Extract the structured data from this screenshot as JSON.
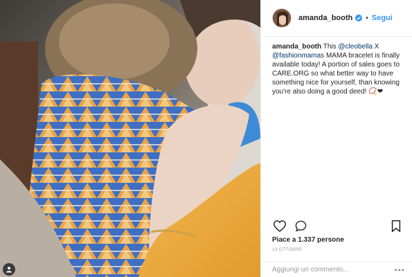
{
  "post": {
    "image_alt": "Woman hugging a child wearing a patterned jacket",
    "tag_icon": "person-tag-icon"
  },
  "header": {
    "username": "amanda_booth",
    "verified_icon": "verified-badge-icon",
    "separator": "•",
    "follow_label": "Segui"
  },
  "caption": {
    "username": "amanda_booth",
    "text_before": "This ",
    "mention1": "@cleobella",
    "text_mid": " X ",
    "mention2": "@fashionmamas",
    "text_after": " MAMA bracelet is finally available today! A portion of sales goes to CARE.ORG so what better way to have something nice for yourself, than knowing you're also doing a good deed! 📿❤"
  },
  "actions": {
    "like_icon": "heart-icon",
    "comment_icon": "comment-icon",
    "save_icon": "bookmark-icon"
  },
  "likes_text": "Piace a 1.337 persone",
  "date_text": "13 OTTOBRE",
  "comment": {
    "placeholder": "Aggiungi un commento...",
    "more_label": "•••"
  },
  "colors": {
    "link": "#3897f0",
    "mention": "#003569",
    "text": "#262626",
    "muted": "#999999"
  }
}
